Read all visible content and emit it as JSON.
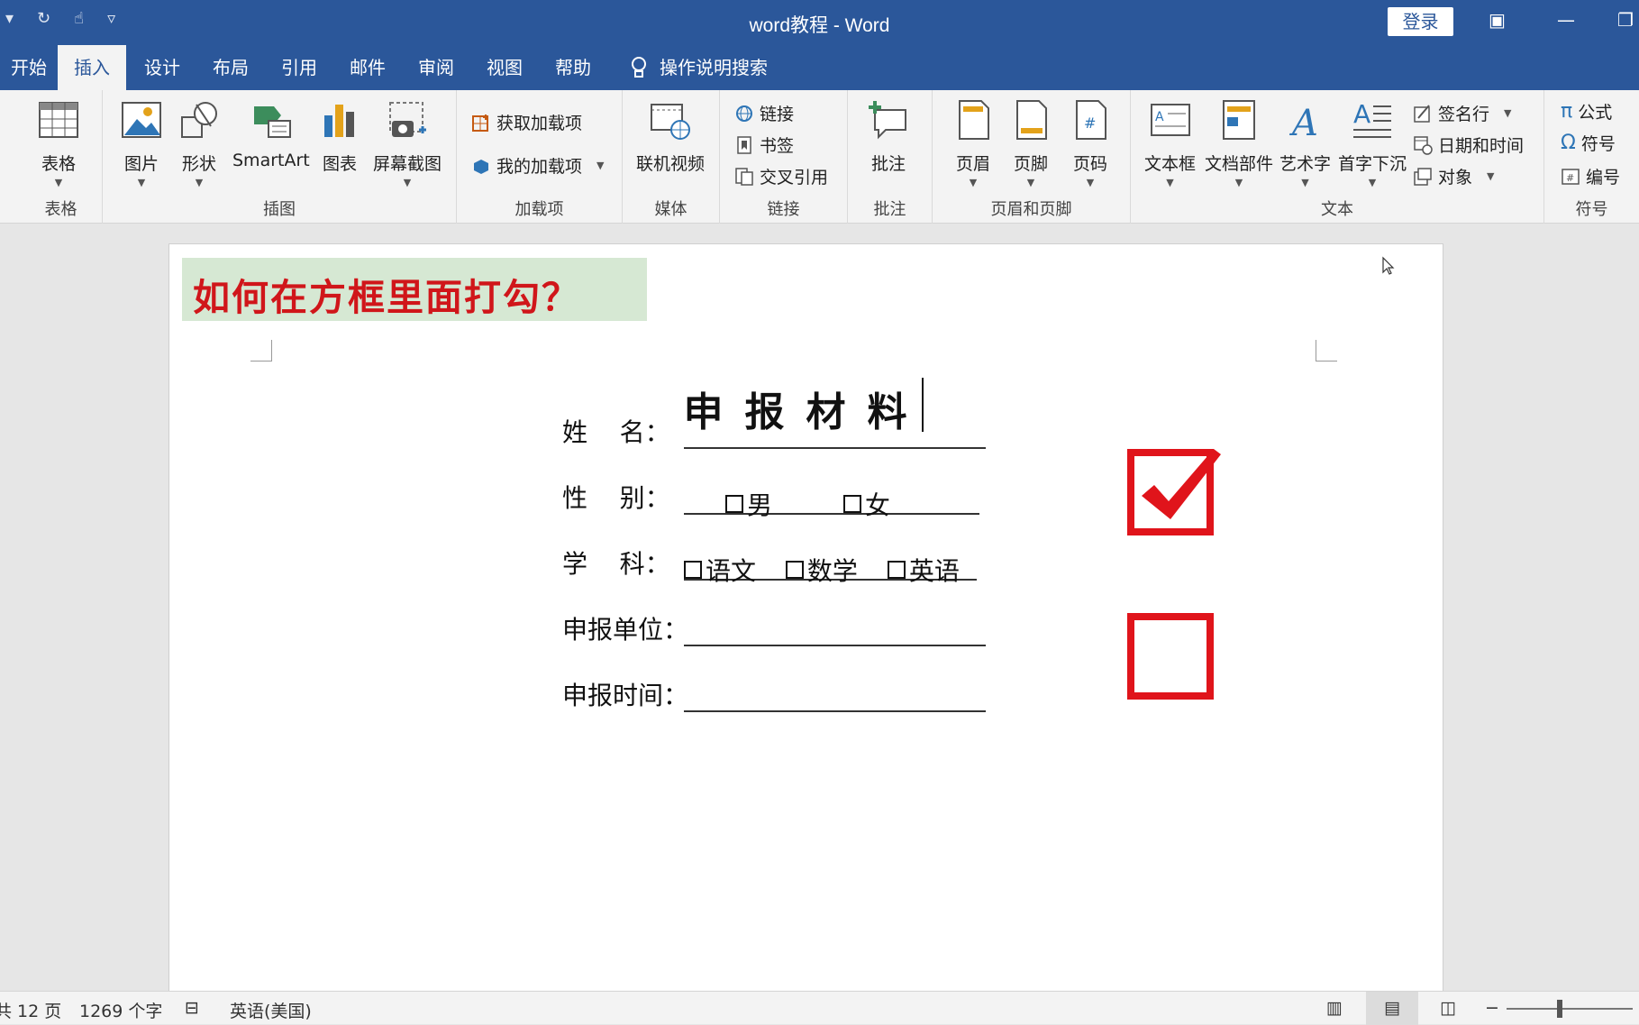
{
  "window": {
    "title": "word教程  -  Word",
    "login_label": "登录",
    "colors": {
      "title_bar": "#2b579a",
      "ribbon": "#f3f3f3",
      "accent_red": "#e0141b"
    }
  },
  "tabs": [
    {
      "label": "开始"
    },
    {
      "label": "插入"
    },
    {
      "label": "设计"
    },
    {
      "label": "布局"
    },
    {
      "label": "引用"
    },
    {
      "label": "邮件"
    },
    {
      "label": "审阅"
    },
    {
      "label": "视图"
    },
    {
      "label": "帮助"
    }
  ],
  "tell_me": "操作说明搜索",
  "ribbon": {
    "tables": {
      "label": "表格",
      "btn": "表格"
    },
    "illustrations": {
      "label": "插图",
      "picture": "图片",
      "shapes": "形状",
      "smartart": "SmartArt",
      "chart": "图表",
      "screenshot": "屏幕截图"
    },
    "addins": {
      "label": "加载项",
      "get": "获取加载项",
      "mine": "我的加载项"
    },
    "media": {
      "label": "媒体",
      "video": "联机视频"
    },
    "links": {
      "label": "链接",
      "link": "链接",
      "bookmark": "书签",
      "crossref": "交叉引用"
    },
    "comments": {
      "label": "批注",
      "comment": "批注"
    },
    "header_footer": {
      "label": "页眉和页脚",
      "header": "页眉",
      "footer": "页脚",
      "page_number": "页码"
    },
    "text": {
      "label": "文本",
      "textbox": "文本框",
      "quickparts": "文档部件",
      "wordart": "艺术字",
      "dropcap": "首字下沉",
      "signature": "签名行",
      "datetime": "日期和时间",
      "object": "对象"
    },
    "symbols": {
      "label": "符号",
      "equation": "公式",
      "symbol": "符号",
      "numbering": "编号"
    }
  },
  "document": {
    "banner": "如何在方框里面打勾？",
    "title": "申报材料",
    "form": {
      "name_label": "姓    名：",
      "gender_label": "性    别：",
      "gender_options": [
        "男",
        "女"
      ],
      "subject_label": "学    科：",
      "subject_options": [
        "语文",
        "数学",
        "英语"
      ],
      "unit_label": "申报单位：",
      "time_label": "申报时间："
    }
  },
  "statusbar": {
    "pages": "共 12 页",
    "words": "1269 个字",
    "language": "英语(美国)"
  }
}
